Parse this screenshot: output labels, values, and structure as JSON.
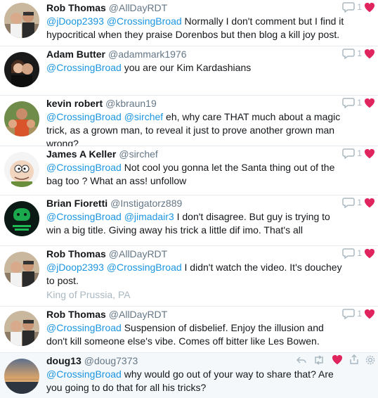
{
  "colors": {
    "mention": "#1b95e0",
    "heart": "#e0245e",
    "muted": "#aab8c2"
  },
  "tweets": [
    {
      "name": "Rob Thomas",
      "handle": "@AllDayRDT",
      "parts": [
        {
          "t": "@jDoop2393",
          "m": true
        },
        {
          "t": " ",
          "m": false
        },
        {
          "t": "@CrossingBroad",
          "m": true
        },
        {
          "t": " Normally I don't comment but I find it hypocritical when they praise Dorenbos but then blog a kill joy post.",
          "m": false
        }
      ],
      "like_count": "1",
      "avatar_icon": "two-men-photo"
    },
    {
      "name": "Adam Butter",
      "handle": "@adammark1976",
      "parts": [
        {
          "t": "@CrossingBroad",
          "m": true
        },
        {
          "t": " you are our Kim Kardashians",
          "m": false
        }
      ],
      "like_count": "1",
      "avatar_icon": "couple-photo"
    },
    {
      "name": "kevin robert",
      "handle": "@kbraun19",
      "parts": [
        {
          "t": "@CrossingBroad",
          "m": true
        },
        {
          "t": " ",
          "m": false
        },
        {
          "t": "@sirchef",
          "m": true
        },
        {
          "t": " eh, why care THAT much about a magic trick, as a grown man, to reveal it just to prove another grown man wrong?",
          "m": false
        }
      ],
      "like_count": "1",
      "avatar_icon": "father-kids-photo"
    },
    {
      "name": "James A Keller",
      "handle": "@sirchef",
      "parts": [
        {
          "t": "@CrossingBroad",
          "m": true
        },
        {
          "t": " Not cool you gonna let the Santa thing out of the bag too ? What an ass! unfollow",
          "m": false
        }
      ],
      "like_count": "1",
      "avatar_icon": "cartoon-face"
    },
    {
      "name": "Brian Fioretti",
      "handle": "@Instigatorz889",
      "parts": [
        {
          "t": "@CrossingBroad",
          "m": true
        },
        {
          "t": " ",
          "m": false
        },
        {
          "t": "@jimadair3",
          "m": true
        },
        {
          "t": " I don't disagree. But guy is trying to win a big title. Giving away his trick a little dif imo. That's all",
          "m": false
        }
      ],
      "like_count": "1",
      "avatar_icon": "snake-logo"
    },
    {
      "name": "Rob Thomas",
      "handle": "@AllDayRDT",
      "parts": [
        {
          "t": "@jDoop2393",
          "m": true
        },
        {
          "t": " ",
          "m": false
        },
        {
          "t": "@CrossingBroad",
          "m": true
        },
        {
          "t": " I didn't watch the video. It's douchey to post.",
          "m": false
        }
      ],
      "location": "King of Prussia, PA",
      "like_count": "1",
      "avatar_icon": "two-men-photo"
    },
    {
      "name": "Rob Thomas",
      "handle": "@AllDayRDT",
      "parts": [
        {
          "t": "@CrossingBroad",
          "m": true
        },
        {
          "t": " Suspension of disbelief. Enjoy the illusion and don't kill someone else's vibe. Comes off bitter like Les Bowen.",
          "m": false
        }
      ],
      "like_count": "1",
      "avatar_icon": "two-men-photo"
    },
    {
      "name": "doug13",
      "handle": "@doug7373",
      "parts": [
        {
          "t": "@CrossingBroad",
          "m": true
        },
        {
          "t": " why would go out of your way to share that? Are you going to do that for all his tricks?",
          "m": false
        }
      ],
      "avatar_icon": "sunset-photo",
      "actions": [
        "reply-icon",
        "retweet-icon",
        "heart-icon",
        "share-icon",
        "gear-icon"
      ]
    }
  ]
}
